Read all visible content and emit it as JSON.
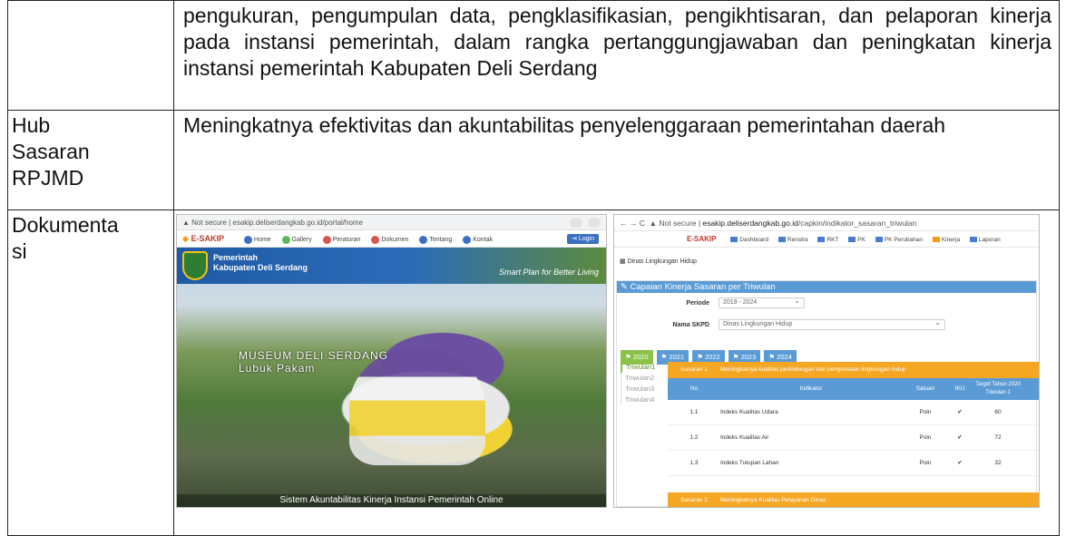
{
  "table": {
    "row1": {
      "col2": "pengukuran, pengumpulan data, pengklasifikasian, pengikhtisaran, dan pelaporan kinerja pada instansi pemerintah, dalam rangka pertanggungjawaban dan peningkatan kinerja instansi pemerintah Kabupaten Deli Serdang"
    },
    "row2": {
      "label_line1": "Hub",
      "label_line2": "Sasaran",
      "label_line3": "RPJMD",
      "col2": "Meningkatnya efektivitas dan akuntabilitas penyelenggaraan pemerintahan daerah"
    },
    "row3": {
      "label_line1": "Dokumenta",
      "label_line2": "si"
    }
  },
  "screenshot_portal": {
    "security": "Not secure",
    "url": "esakip.deliserdangkab.go.id/portal/home",
    "logo": "E-SAKIP",
    "nav": [
      "Home",
      "Gallery",
      "Peraturan",
      "Dokumen",
      "Tentang",
      "Kontak"
    ],
    "login": "Login",
    "banner_line1": "Pemerintah",
    "banner_line2": "Kabupaten Deli Serdang",
    "tagline": "Smart Plan for Better Living",
    "museum_line1": "MUSEUM DELI SERDANG",
    "museum_line2": "Lubuk Pakam",
    "footer": "Sistem Akuntabilitas Kinerja Instansi Pemerintah Online"
  },
  "screenshot_indikator": {
    "security": "Not secure",
    "url_host": "esakip.deliserdangkab.go.id",
    "url_path": "/capkin/indikator_sasaran_triwulan",
    "logo": "E-SAKIP",
    "nav": [
      "Dashboard",
      "Renstra",
      "RKT",
      "PK",
      "PK Perubahan",
      "Kinerja",
      "Laporan"
    ],
    "breadcrumb": "Dinas Lingkungan Hidup",
    "panel_title": "Capaian Kinerja Sasaran per Triwulan",
    "periode_label": "Periode",
    "periode_value": "2019 - 2024",
    "skpd_label": "Nama SKPD",
    "skpd_value": "Dinas Lingkungan Hidup",
    "year_tabs": [
      "2020",
      "2021",
      "2022",
      "2023",
      "2024"
    ],
    "triwulan": [
      "Triwulan1",
      "Triwulan2",
      "Triwulan3",
      "Triwulan4"
    ],
    "sasaran1_label": "Sasaran 1",
    "sasaran1_text": "Meningkatnya kualitas perlindungan dan pengelolaan lingkungan hidup",
    "headers": {
      "no": "No",
      "indikator": "Indikator",
      "satuan": "Satuan",
      "iku": "IKU",
      "target": "Target Tahun 2020 Triwulan 1"
    },
    "rows": [
      {
        "no": "1.1",
        "indikator": "Indeks Kualitas Udara",
        "satuan": "Poin",
        "iku": "✔",
        "target": "60"
      },
      {
        "no": "1.2",
        "indikator": "Indeks Kualitas Air",
        "satuan": "Poin",
        "iku": "✔",
        "target": "72"
      },
      {
        "no": "1.3",
        "indikator": "Indeks Tutupan Lahan",
        "satuan": "Poin",
        "iku": "✔",
        "target": "32"
      }
    ],
    "sasaran2_label": "Sasaran 2",
    "sasaran2_text": "Meningkatnya Kualitas Pelayanan Dinas"
  }
}
